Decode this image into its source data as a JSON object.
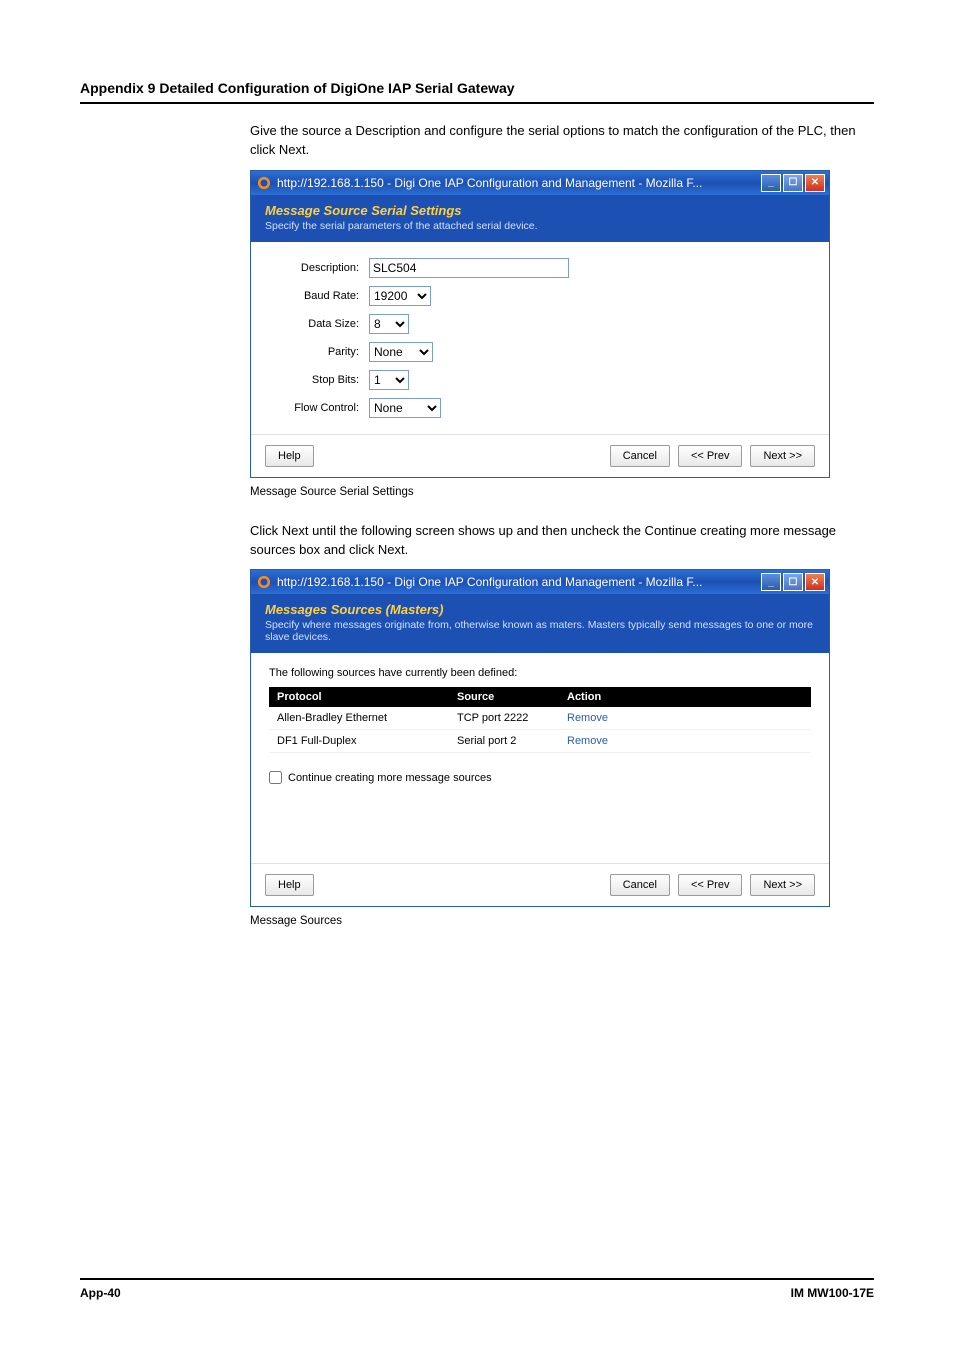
{
  "appendix_header": "Appendix 9  Detailed Configuration of DigiOne IAP Serial Gateway",
  "intro1": "Give the source a Description and configure the serial options to match the configuration of the PLC, then click Next.",
  "caption1": "Message Source Serial Settings",
  "intro2": "Click Next until the following screen shows up and then uncheck the Continue creating more message sources box and click Next.",
  "caption2": "Message Sources",
  "window_title": "http://192.168.1.150 - Digi One IAP Configuration and Management - Mozilla F...",
  "dlg1": {
    "title": "Message Source Serial Settings",
    "sub": "Specify the serial parameters of the attached serial device.",
    "labels": {
      "description": "Description:",
      "baud": "Baud Rate:",
      "data": "Data Size:",
      "parity": "Parity:",
      "stop": "Stop Bits:",
      "flow": "Flow Control:"
    },
    "values": {
      "description": "SLC504",
      "baud": "19200",
      "data": "8",
      "parity": "None",
      "stop": "1",
      "flow": "None"
    }
  },
  "dlg2": {
    "title": "Messages Sources (Masters)",
    "sub": "Specify where messages originate from, otherwise known as maters. Masters typically send messages to one or more slave devices.",
    "intro": "The following sources have currently been defined:",
    "headers": {
      "protocol": "Protocol",
      "source": "Source",
      "action": "Action"
    },
    "rows": [
      {
        "protocol": "Allen-Bradley Ethernet",
        "source": "TCP port 2222",
        "action": "Remove"
      },
      {
        "protocol": "DF1 Full-Duplex",
        "source": "Serial port 2",
        "action": "Remove"
      }
    ],
    "checkbox_label": "Continue creating more message sources"
  },
  "buttons": {
    "help": "Help",
    "cancel": "Cancel",
    "prev": "<< Prev",
    "next": "Next >>"
  },
  "footer": {
    "left": "App-40",
    "right": "IM MW100-17E"
  }
}
